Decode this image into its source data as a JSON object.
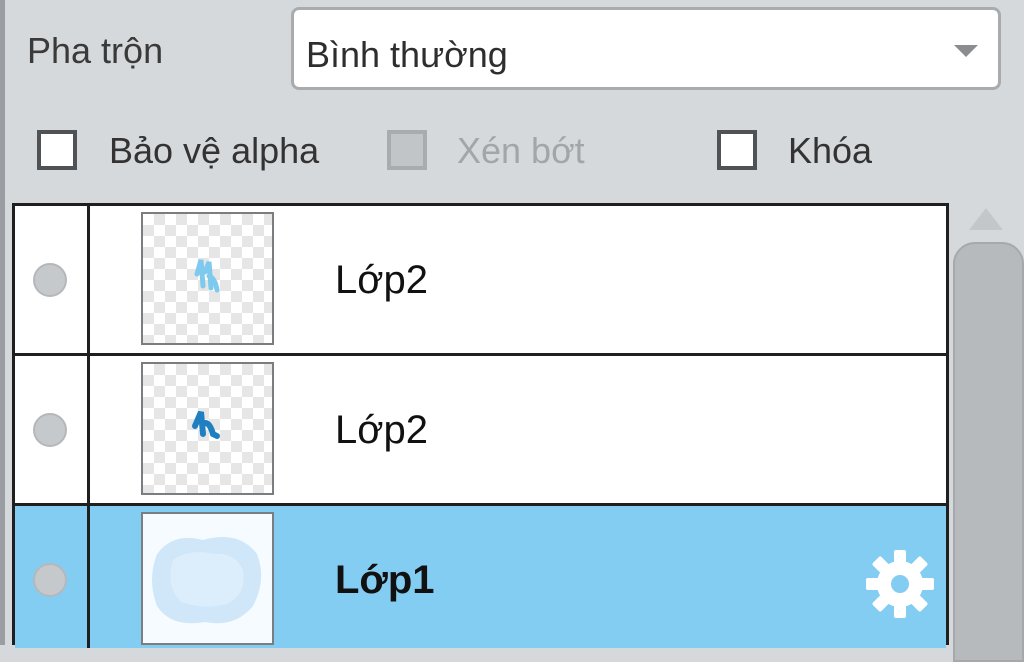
{
  "blend": {
    "label": "Pha trộn",
    "value": "Bình thường"
  },
  "options": {
    "protect_alpha": {
      "label": "Bảo vệ alpha",
      "checked": false
    },
    "clip": {
      "label": "Xén bớt",
      "checked": false,
      "enabled": false
    },
    "lock": {
      "label": "Khóa",
      "checked": false
    }
  },
  "layers": [
    {
      "name": "Lớp2",
      "selected": false
    },
    {
      "name": "Lớp2",
      "selected": false
    },
    {
      "name": "Lớp1",
      "selected": true
    }
  ],
  "colors": {
    "selected_row": "#84cdf2",
    "panel_bg": "#d6d9dc"
  }
}
